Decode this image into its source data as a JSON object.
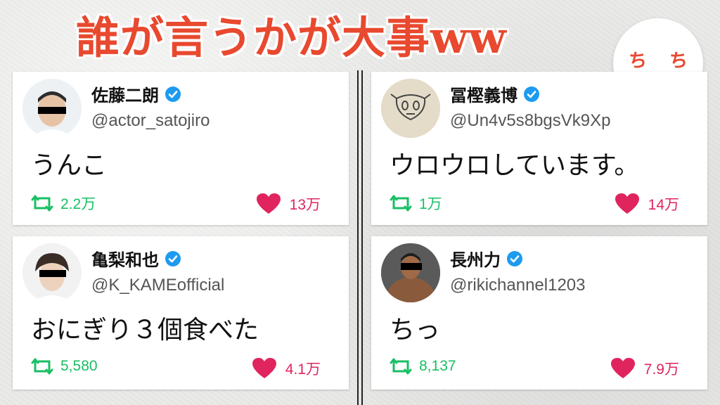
{
  "title": "誰が言うかが大事ww",
  "logo": {
    "char_left": "ち",
    "char_right": "ち"
  },
  "colors": {
    "retweet": "#17bf63",
    "like": "#e0245e",
    "verified": "#1d9bf0",
    "title": "#e8492f"
  },
  "tweets": [
    {
      "name": "佐藤二朗",
      "handle": "@actor_satojiro",
      "text": "うんこ",
      "retweets": "2.2万",
      "likes": "13万",
      "verified": true,
      "avatar": "man-photo-avatar"
    },
    {
      "name": "冨樫義博",
      "handle": "@Un4v5s8bgsVk9Xp",
      "text": "ウロウロしています。",
      "retweets": "1万",
      "likes": "14万",
      "verified": true,
      "avatar": "doodle-avatar"
    },
    {
      "name": "亀梨和也",
      "handle": "@K_KAMEofficial",
      "text": "おにぎり３個食べた",
      "retweets": "5,580",
      "likes": "4.1万",
      "verified": true,
      "avatar": "man-photo-avatar"
    },
    {
      "name": "長州力",
      "handle": "@rikichannel1203",
      "text": "ちっ",
      "retweets": "8,137",
      "likes": "7.9万",
      "verified": true,
      "avatar": "wrestler-photo-avatar"
    }
  ]
}
